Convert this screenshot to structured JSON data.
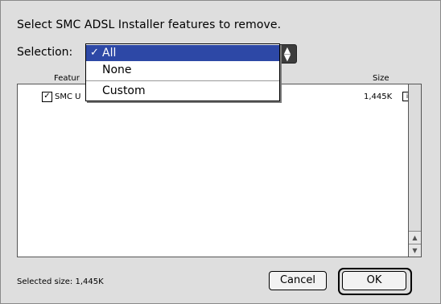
{
  "dialog": {
    "prompt": "Select SMC ADSL Installer features to remove.",
    "selection_label": "Selection:",
    "popup": {
      "arrows_icon": "up-down-arrows-icon",
      "menu": {
        "items": [
          {
            "label": "All",
            "checked": true
          },
          {
            "label": "None",
            "checked": false
          },
          {
            "label": "Custom",
            "checked": false
          }
        ],
        "check_mark": "✓"
      }
    },
    "list": {
      "columns": {
        "feature": "Featur",
        "size": "Size"
      },
      "rows": [
        {
          "name": "SMC U",
          "size": "1,445K",
          "checked": true
        }
      ]
    },
    "footer": {
      "selected_size": "Selected size:  1,445K",
      "cancel_label": "Cancel",
      "ok_label": "OK"
    }
  }
}
